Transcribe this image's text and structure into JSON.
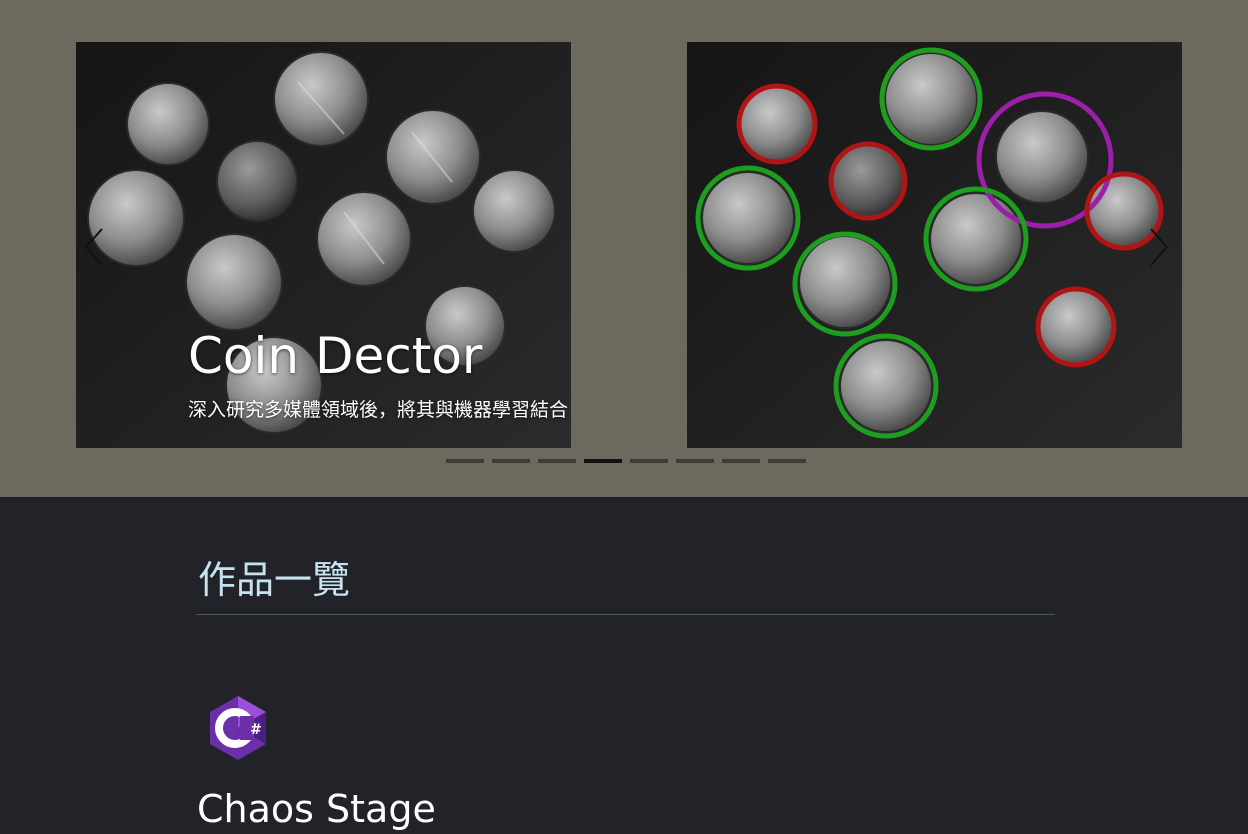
{
  "carousel": {
    "caption_title": "Coin Dector",
    "caption_subtitle": "深入研究多媒體領域後，將其與機器學習結合",
    "prev_icon": "chevron-left-icon",
    "next_icon": "chevron-right-icon",
    "indicator_count": 8,
    "active_indicator": 4
  },
  "works": {
    "heading": "作品一覽",
    "projects": [
      {
        "title": "Chaos Stage",
        "icon": "csharp-logo-icon"
      }
    ]
  },
  "colors": {
    "hero_bg": "#6d695f",
    "page_bg": "#212328",
    "heading": "#c7e3ef",
    "ring_green": "#1e9e1e",
    "ring_red": "#b01414",
    "ring_purple": "#9b1fa8"
  }
}
